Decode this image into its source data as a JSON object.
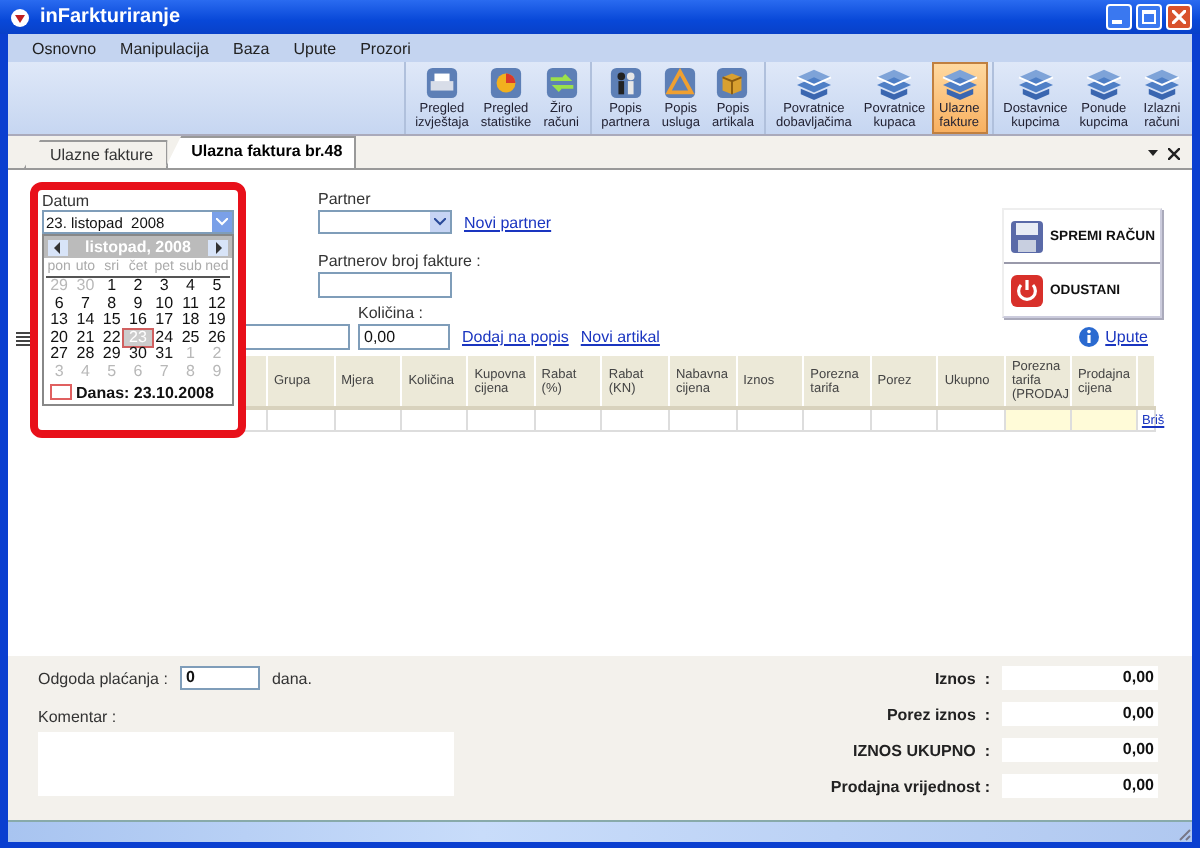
{
  "window": {
    "title": "inFarkturiranje"
  },
  "menu": [
    "Osnovno",
    "Manipulacija",
    "Baza",
    "Upute",
    "Prozori"
  ],
  "toolbar": {
    "groups": [
      {
        "buttons": [
          {
            "label": "Pregled\nizvještaja",
            "kind": "report",
            "selected": false
          },
          {
            "label": "Pregled\nstatistike",
            "kind": "chart",
            "selected": false
          },
          {
            "label": "Žiro\nračuni",
            "kind": "transfer",
            "selected": false
          }
        ]
      },
      {
        "buttons": [
          {
            "label": "Popis\npartnera",
            "kind": "people",
            "selected": false
          },
          {
            "label": "Popis\nusluga",
            "kind": "tools",
            "selected": false
          },
          {
            "label": "Popis\nartikala",
            "kind": "box",
            "selected": false
          }
        ]
      },
      {
        "buttons": [
          {
            "label": "Povratnice\ndobavljačima",
            "kind": "document",
            "selected": false
          },
          {
            "label": "Povratnice\nkupaca",
            "kind": "document",
            "selected": false
          },
          {
            "label": "Ulazne\nfakture",
            "kind": "document",
            "selected": true
          }
        ]
      },
      {
        "buttons": [
          {
            "label": "Dostavnice\nkupcima",
            "kind": "document",
            "selected": false
          },
          {
            "label": "Ponude\nkupcima",
            "kind": "document",
            "selected": false
          },
          {
            "label": "Izlazni\nračuni",
            "kind": "document",
            "selected": false
          }
        ]
      }
    ]
  },
  "tabs": [
    {
      "label": "Ulazne fakture",
      "selected": false
    },
    {
      "label": "Ulazna faktura br.48",
      "selected": true
    }
  ],
  "form": {
    "date_label": "Datum",
    "date_value": "23. listopad  2008",
    "partner_label": "Partner",
    "new_partner_link": "Novi partner",
    "partner_invoice_label": "Partnerov broj fakture :",
    "quantity_label": "Količina :",
    "quantity_value": "0,00",
    "add_link": "Dodaj na popis",
    "new_item_link": "Novi artikal",
    "help_link": "Upute"
  },
  "actions": [
    {
      "label": "SPREMI RAČUN",
      "kind": "save"
    },
    {
      "label": "ODUSTANI",
      "kind": "cancel"
    }
  ],
  "calendar": {
    "month": "listopad, 2008",
    "weekdays": [
      "pon",
      "uto",
      "sri",
      "čet",
      "pet",
      "sub",
      "ned"
    ],
    "weeks": [
      [
        {
          "day": "29",
          "other_month": true,
          "selected": false
        },
        {
          "day": "30",
          "other_month": true,
          "selected": false
        },
        {
          "day": "1",
          "other_month": false,
          "selected": false
        },
        {
          "day": "2",
          "other_month": false,
          "selected": false
        },
        {
          "day": "3",
          "other_month": false,
          "selected": false
        },
        {
          "day": "4",
          "other_month": false,
          "selected": false
        },
        {
          "day": "5",
          "other_month": false,
          "selected": false
        }
      ],
      [
        {
          "day": "6",
          "other_month": false,
          "selected": false
        },
        {
          "day": "7",
          "other_month": false,
          "selected": false
        },
        {
          "day": "8",
          "other_month": false,
          "selected": false
        },
        {
          "day": "9",
          "other_month": false,
          "selected": false
        },
        {
          "day": "10",
          "other_month": false,
          "selected": false
        },
        {
          "day": "11",
          "other_month": false,
          "selected": false
        },
        {
          "day": "12",
          "other_month": false,
          "selected": false
        }
      ],
      [
        {
          "day": "13",
          "other_month": false,
          "selected": false
        },
        {
          "day": "14",
          "other_month": false,
          "selected": false
        },
        {
          "day": "15",
          "other_month": false,
          "selected": false
        },
        {
          "day": "16",
          "other_month": false,
          "selected": false
        },
        {
          "day": "17",
          "other_month": false,
          "selected": false
        },
        {
          "day": "18",
          "other_month": false,
          "selected": false
        },
        {
          "day": "19",
          "other_month": false,
          "selected": false
        }
      ],
      [
        {
          "day": "20",
          "other_month": false,
          "selected": false
        },
        {
          "day": "21",
          "other_month": false,
          "selected": false
        },
        {
          "day": "22",
          "other_month": false,
          "selected": false
        },
        {
          "day": "23",
          "other_month": false,
          "selected": true
        },
        {
          "day": "24",
          "other_month": false,
          "selected": false
        },
        {
          "day": "25",
          "other_month": false,
          "selected": false
        },
        {
          "day": "26",
          "other_month": false,
          "selected": false
        }
      ],
      [
        {
          "day": "27",
          "other_month": false,
          "selected": false
        },
        {
          "day": "28",
          "other_month": false,
          "selected": false
        },
        {
          "day": "29",
          "other_month": false,
          "selected": false
        },
        {
          "day": "30",
          "other_month": false,
          "selected": false
        },
        {
          "day": "31",
          "other_month": false,
          "selected": false
        },
        {
          "day": "1",
          "other_month": true,
          "selected": false
        },
        {
          "day": "2",
          "other_month": true,
          "selected": false
        }
      ],
      [
        {
          "day": "3",
          "other_month": true,
          "selected": false
        },
        {
          "day": "4",
          "other_month": true,
          "selected": false
        },
        {
          "day": "5",
          "other_month": true,
          "selected": false
        },
        {
          "day": "6",
          "other_month": true,
          "selected": false
        },
        {
          "day": "7",
          "other_month": true,
          "selected": false
        },
        {
          "day": "8",
          "other_month": true,
          "selected": false
        },
        {
          "day": "9",
          "other_month": true,
          "selected": false
        }
      ]
    ],
    "today": "Danas: 23.10.2008"
  },
  "table": {
    "columns": [
      {
        "title": "Grupa",
        "highlighted": false
      },
      {
        "title": "Mjera",
        "highlighted": false
      },
      {
        "title": "Količina",
        "highlighted": false
      },
      {
        "title": "Kupovna cijena",
        "highlighted": false
      },
      {
        "title": "Rabat (%)",
        "highlighted": false
      },
      {
        "title": "Rabat (KN)",
        "highlighted": false
      },
      {
        "title": "Nabavna cijena",
        "highlighted": false
      },
      {
        "title": "Iznos",
        "highlighted": false
      },
      {
        "title": "Porezna tarifa",
        "highlighted": false
      },
      {
        "title": "Porez",
        "highlighted": false
      },
      {
        "title": "Ukupno",
        "highlighted": false
      },
      {
        "title": "Porezna tarifa (PRODAJ",
        "highlighted": true
      },
      {
        "title": "Prodajna cijena",
        "highlighted": true
      }
    ],
    "rows": [
      {
        "action": "Briš"
      }
    ]
  },
  "footer": {
    "delay_label": "Odgoda plaćanja :",
    "delay_value": "0",
    "delay_unit": "dana.",
    "comment_label": "Komentar :",
    "totals": [
      {
        "label": "Iznos  :",
        "value": "0,00"
      },
      {
        "label": "Porez iznos  :",
        "value": "0,00"
      },
      {
        "label": "IZNOS UKUPNO  :",
        "value": "0,00"
      },
      {
        "label": "Prodajna vrijednost :",
        "value": "0,00"
      }
    ]
  }
}
